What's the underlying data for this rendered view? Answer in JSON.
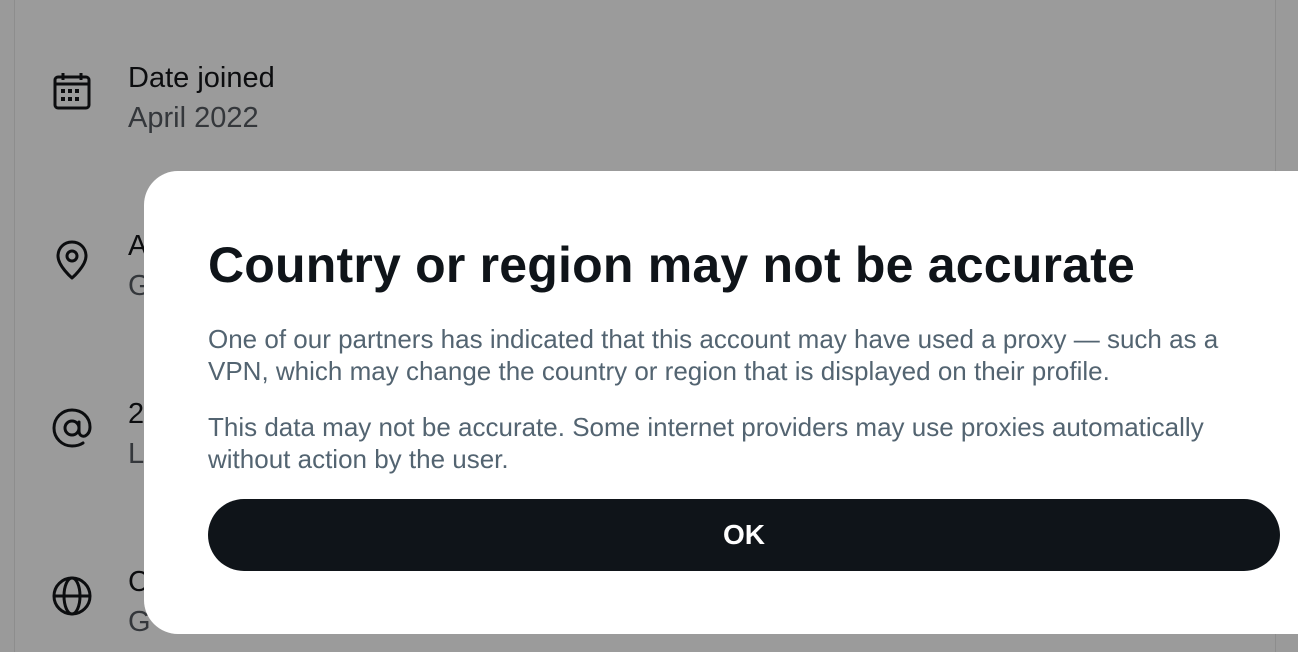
{
  "background": {
    "rows": [
      {
        "icon": "calendar-icon",
        "label": "Date joined",
        "value": "April 2022"
      },
      {
        "icon": "location-pin-icon",
        "label": "A",
        "value": "G"
      },
      {
        "icon": "at-sign-icon",
        "label": "2",
        "value": "L"
      },
      {
        "icon": "globe-icon",
        "label": "C",
        "value": "G"
      }
    ]
  },
  "modal": {
    "title": "Country or region may not be accurate",
    "paragraph_1": "One of our partners has indicated that this account may have used a proxy — such as a VPN, which may change the country or region that is displayed on their profile.",
    "paragraph_2": "This data may not be accurate. Some internet providers may use proxies automatically without action by the user.",
    "ok_label": "OK"
  },
  "colors": {
    "overlay": "#9b9b9b",
    "modal_background": "#ffffff",
    "title_text": "#0f1419",
    "body_text": "#536471",
    "button_background": "#0f1419",
    "button_text": "#ffffff"
  }
}
